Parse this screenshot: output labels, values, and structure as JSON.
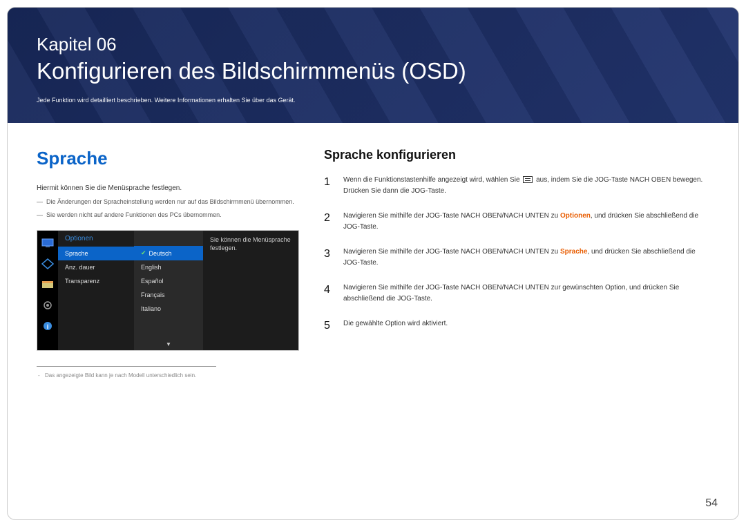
{
  "header": {
    "chapter_label": "Kapitel 06",
    "chapter_title": "Konfigurieren des Bildschirmmenüs (OSD)",
    "chapter_sub": "Jede Funktion wird detailliert beschrieben. Weitere Informationen erhalten Sie über das Gerät."
  },
  "left": {
    "h2": "Sprache",
    "desc": "Hiermit können Sie die Menüsprache festlegen.",
    "note1": "Die Änderungen der Spracheinstellung werden nur auf das Bildschirmmenü übernommen.",
    "note2": "Sie werden nicht auf andere Funktionen des PCs übernommen.",
    "footnote": "Das angezeigte Bild kann je nach Modell unterschiedlich sein."
  },
  "osd": {
    "menu_title": "Optionen",
    "items": [
      "Sprache",
      "Anz. dauer",
      "Transparenz"
    ],
    "langs": [
      "Deutsch",
      "English",
      "Español",
      "Français",
      "Italiano"
    ],
    "help": "Sie können die Menüsprache festlegen."
  },
  "right": {
    "h3": "Sprache konfigurieren",
    "steps": [
      {
        "num": "1",
        "pre": "Wenn die Funktionstastenhilfe angezeigt wird, wählen Sie ",
        "post": " aus, indem Sie die JOG-Taste NACH OBEN bewegen. Drücken Sie dann die JOG-Taste."
      },
      {
        "num": "2",
        "pre": "Navigieren Sie mithilfe der JOG-Taste NACH OBEN/NACH UNTEN zu ",
        "hl": "Optionen",
        "post": ", und drücken Sie abschließend die JOG-Taste."
      },
      {
        "num": "3",
        "pre": "Navigieren Sie mithilfe der JOG-Taste NACH OBEN/NACH UNTEN zu ",
        "hl": "Sprache",
        "post": ", und drücken Sie abschließend die JOG-Taste."
      },
      {
        "num": "4",
        "text": "Navigieren Sie mithilfe der JOG-Taste NACH OBEN/NACH UNTEN zur gewünschten Option, und drücken Sie abschließend die JOG-Taste."
      },
      {
        "num": "5",
        "text": "Die gewählte Option wird aktiviert."
      }
    ]
  },
  "page_num": "54"
}
